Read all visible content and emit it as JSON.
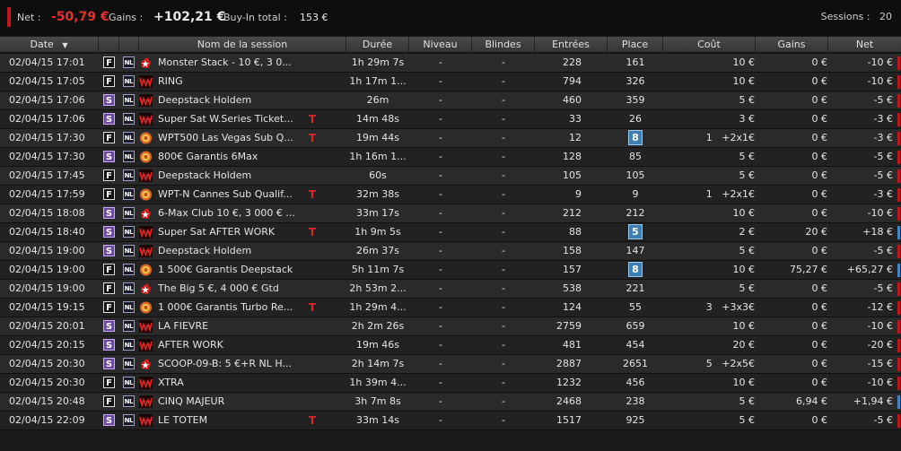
{
  "summary": {
    "net_label": "Net :",
    "net_value": "-50,79 €",
    "gains_label": "Gains :",
    "gains_value": "+102,21 €",
    "buyin_label": "Buy-In total :",
    "buyin_value": "153 €",
    "sessions_label": "Sessions :",
    "sessions_value": "20"
  },
  "colors": {
    "negative": "#c0141a",
    "positive": "#3d86c8",
    "accent_red": "#e0312d"
  },
  "columns": {
    "date": "Date",
    "sort_icon": "▼",
    "session_name": "Nom de la session",
    "duration": "Durée",
    "level": "Niveau",
    "blinds": "Blindes",
    "entries": "Entrées",
    "place": "Place",
    "cost": "Coût",
    "gains": "Gains",
    "net": "Net"
  },
  "rows": [
    {
      "date": "02/04/15 17:01",
      "format": "F",
      "game": "NL",
      "room": "pokerstars-icon",
      "name": "Monster Stack - 10 €, 3 0...",
      "t": false,
      "duration": "1h 29m 7s",
      "level": "-",
      "blinds": "-",
      "entries": "228",
      "place": "161",
      "place_hl": false,
      "cost_x": "",
      "cost": "10 €",
      "gains": "0 €",
      "net": "-10 €",
      "sign": "neg"
    },
    {
      "date": "02/04/15 17:05",
      "format": "F",
      "game": "NL",
      "room": "winamax-icon",
      "name": "RING",
      "t": false,
      "duration": "1h 17m 1...",
      "level": "-",
      "blinds": "-",
      "entries": "794",
      "place": "326",
      "place_hl": false,
      "cost_x": "",
      "cost": "10 €",
      "gains": "0 €",
      "net": "-10 €",
      "sign": "neg"
    },
    {
      "date": "02/04/15 17:06",
      "format": "S",
      "game": "NL",
      "room": "winamax-icon",
      "name": "Deepstack Holdem",
      "t": false,
      "duration": "26m",
      "level": "-",
      "blinds": "-",
      "entries": "460",
      "place": "359",
      "place_hl": false,
      "cost_x": "",
      "cost": "5 €",
      "gains": "0 €",
      "net": "-5 €",
      "sign": "neg"
    },
    {
      "date": "02/04/15 17:06",
      "format": "S",
      "game": "NL",
      "room": "winamax-icon",
      "name": "Super Sat W.Series Ticket...",
      "t": true,
      "duration": "14m 48s",
      "level": "-",
      "blinds": "-",
      "entries": "33",
      "place": "26",
      "place_hl": false,
      "cost_x": "",
      "cost": "3 €",
      "gains": "0 €",
      "net": "-3 €",
      "sign": "neg"
    },
    {
      "date": "02/04/15 17:30",
      "format": "F",
      "game": "NL",
      "room": "chip-icon",
      "name": "WPT500 Las Vegas Sub Q...",
      "t": true,
      "duration": "19m 44s",
      "level": "-",
      "blinds": "-",
      "entries": "12",
      "place": "8",
      "place_hl": true,
      "cost_x": "1   +2x1€",
      "cost": "",
      "gains": "0 €",
      "net": "-3 €",
      "sign": "neg"
    },
    {
      "date": "02/04/15 17:30",
      "format": "S",
      "game": "NL",
      "room": "chip-icon",
      "name": "800€ Garantis 6Max",
      "t": false,
      "duration": "1h 16m 1...",
      "level": "-",
      "blinds": "-",
      "entries": "128",
      "place": "85",
      "place_hl": false,
      "cost_x": "",
      "cost": "5 €",
      "gains": "0 €",
      "net": "-5 €",
      "sign": "neg"
    },
    {
      "date": "02/04/15 17:45",
      "format": "F",
      "game": "NL",
      "room": "winamax-icon",
      "name": "Deepstack Holdem",
      "t": false,
      "duration": "60s",
      "level": "-",
      "blinds": "-",
      "entries": "105",
      "place": "105",
      "place_hl": false,
      "cost_x": "",
      "cost": "5 €",
      "gains": "0 €",
      "net": "-5 €",
      "sign": "neg"
    },
    {
      "date": "02/04/15 17:59",
      "format": "F",
      "game": "NL",
      "room": "chip-icon",
      "name": "WPT-N Cannes Sub Qualif...",
      "t": true,
      "duration": "32m 38s",
      "level": "-",
      "blinds": "-",
      "entries": "9",
      "place": "9",
      "place_hl": false,
      "cost_x": "1   +2x1€",
      "cost": "",
      "gains": "0 €",
      "net": "-3 €",
      "sign": "neg"
    },
    {
      "date": "02/04/15 18:08",
      "format": "S",
      "game": "NL",
      "room": "pokerstars-icon",
      "name": "6-Max Club 10 €, 3 000 € ...",
      "t": false,
      "duration": "33m 17s",
      "level": "-",
      "blinds": "-",
      "entries": "212",
      "place": "212",
      "place_hl": false,
      "cost_x": "",
      "cost": "10 €",
      "gains": "0 €",
      "net": "-10 €",
      "sign": "neg"
    },
    {
      "date": "02/04/15 18:40",
      "format": "S",
      "game": "NL",
      "room": "winamax-icon",
      "name": "Super Sat AFTER WORK",
      "t": true,
      "duration": "1h 9m 5s",
      "level": "-",
      "blinds": "-",
      "entries": "88",
      "place": "5",
      "place_hl": true,
      "cost_x": "",
      "cost": "2 €",
      "gains": "20 €",
      "net": "+18 €",
      "sign": "pos"
    },
    {
      "date": "02/04/15 19:00",
      "format": "S",
      "game": "NL",
      "room": "winamax-icon",
      "name": "Deepstack Holdem",
      "t": false,
      "duration": "26m 37s",
      "level": "-",
      "blinds": "-",
      "entries": "158",
      "place": "147",
      "place_hl": false,
      "cost_x": "",
      "cost": "5 €",
      "gains": "0 €",
      "net": "-5 €",
      "sign": "neg"
    },
    {
      "date": "02/04/15 19:00",
      "format": "F",
      "game": "NL",
      "room": "chip-icon",
      "name": "1 500€ Garantis Deepstack",
      "t": false,
      "duration": "5h 11m 7s",
      "level": "-",
      "blinds": "-",
      "entries": "157",
      "place": "8",
      "place_hl": true,
      "cost_x": "",
      "cost": "10 €",
      "gains": "75,27 €",
      "net": "+65,27 €",
      "sign": "pos"
    },
    {
      "date": "02/04/15 19:00",
      "format": "F",
      "game": "NL",
      "room": "pokerstars-icon",
      "name": "The Big 5 €, 4 000 € Gtd",
      "t": false,
      "duration": "2h 53m 2...",
      "level": "-",
      "blinds": "-",
      "entries": "538",
      "place": "221",
      "place_hl": false,
      "cost_x": "",
      "cost": "5 €",
      "gains": "0 €",
      "net": "-5 €",
      "sign": "neg"
    },
    {
      "date": "02/04/15 19:15",
      "format": "F",
      "game": "NL",
      "room": "chip-icon",
      "name": "1 000€ Garantis Turbo Re...",
      "t": true,
      "duration": "1h 29m 4...",
      "level": "-",
      "blinds": "-",
      "entries": "124",
      "place": "55",
      "place_hl": false,
      "cost_x": "3   +3x3€",
      "cost": "",
      "gains": "0 €",
      "net": "-12 €",
      "sign": "neg"
    },
    {
      "date": "02/04/15 20:01",
      "format": "S",
      "game": "NL",
      "room": "winamax-icon",
      "name": "LA FIEVRE",
      "t": false,
      "duration": "2h 2m 26s",
      "level": "-",
      "blinds": "-",
      "entries": "2759",
      "place": "659",
      "place_hl": false,
      "cost_x": "",
      "cost": "10 €",
      "gains": "0 €",
      "net": "-10 €",
      "sign": "neg"
    },
    {
      "date": "02/04/15 20:15",
      "format": "S",
      "game": "NL",
      "room": "winamax-icon",
      "name": "AFTER WORK",
      "t": false,
      "duration": "19m 46s",
      "level": "-",
      "blinds": "-",
      "entries": "481",
      "place": "454",
      "place_hl": false,
      "cost_x": "",
      "cost": "20 €",
      "gains": "0 €",
      "net": "-20 €",
      "sign": "neg"
    },
    {
      "date": "02/04/15 20:30",
      "format": "S",
      "game": "NL",
      "room": "pokerstars-icon",
      "name": "SCOOP-09-B: 5 €+R NL H...",
      "t": false,
      "duration": "2h 14m 7s",
      "level": "-",
      "blinds": "-",
      "entries": "2887",
      "place": "2651",
      "place_hl": false,
      "cost_x": "5   +2x5€",
      "cost": "",
      "gains": "0 €",
      "net": "-15 €",
      "sign": "neg"
    },
    {
      "date": "02/04/15 20:30",
      "format": "F",
      "game": "NL",
      "room": "winamax-icon",
      "name": "XTRA",
      "t": false,
      "duration": "1h 39m 4...",
      "level": "-",
      "blinds": "-",
      "entries": "1232",
      "place": "456",
      "place_hl": false,
      "cost_x": "",
      "cost": "10 €",
      "gains": "0 €",
      "net": "-10 €",
      "sign": "neg"
    },
    {
      "date": "02/04/15 20:48",
      "format": "F",
      "game": "NL",
      "room": "winamax-icon",
      "name": "CINQ MAJEUR",
      "t": false,
      "duration": "3h 7m 8s",
      "level": "-",
      "blinds": "-",
      "entries": "2468",
      "place": "238",
      "place_hl": false,
      "cost_x": "",
      "cost": "5 €",
      "gains": "6,94 €",
      "net": "+1,94 €",
      "sign": "pos"
    },
    {
      "date": "02/04/15 22:09",
      "format": "S",
      "game": "NL",
      "room": "winamax-icon",
      "name": "LE TOTEM",
      "t": true,
      "duration": "33m 14s",
      "level": "-",
      "blinds": "-",
      "entries": "1517",
      "place": "925",
      "place_hl": false,
      "cost_x": "",
      "cost": "5 €",
      "gains": "0 €",
      "net": "-5 €",
      "sign": "neg"
    }
  ],
  "t_glyph": "T"
}
